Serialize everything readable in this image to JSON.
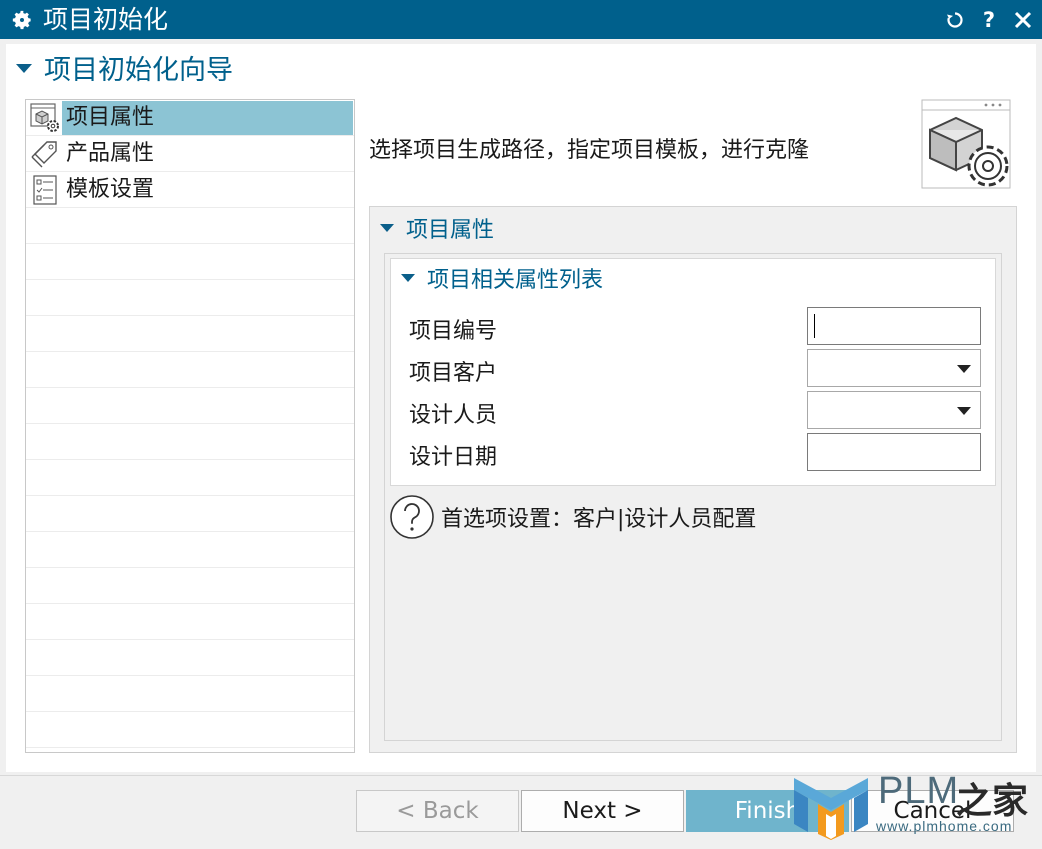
{
  "window": {
    "title": "项目初始化",
    "icon": "gear-icon",
    "controls": [
      "reset-icon",
      "help-icon",
      "close-icon"
    ],
    "help_glyph": "?"
  },
  "wizard": {
    "title": "项目初始化向导"
  },
  "steps": [
    {
      "label": "项目属性",
      "icon": "cube-gear-icon",
      "selected": true
    },
    {
      "label": "产品属性",
      "icon": "tag-icon",
      "selected": false
    },
    {
      "label": "模板设置",
      "icon": "checklist-icon",
      "selected": false
    }
  ],
  "main": {
    "description": "选择项目生成路径，指定项目模板，进行克隆",
    "panel_title": "项目属性",
    "group_title": "项目相关属性列表",
    "fields": [
      {
        "label": "项目编号",
        "type": "text",
        "value": ""
      },
      {
        "label": "项目客户",
        "type": "dropdown",
        "value": ""
      },
      {
        "label": "设计人员",
        "type": "dropdown",
        "value": ""
      },
      {
        "label": "设计日期",
        "type": "text",
        "value": ""
      }
    ],
    "hint": "首选项设置：客户|设计人员配置"
  },
  "buttons": {
    "back": "< Back",
    "next": "Next >",
    "finish": "Finish",
    "cancel": "Cancel"
  },
  "watermark": {
    "brand": "PLM",
    "cn": "之家",
    "url": "www.plmhome.com"
  },
  "colors": {
    "titlebar": "#00608c",
    "accent": "#00608c",
    "selected": "#8cc4d4",
    "primary_button": "#6fb4cc"
  }
}
